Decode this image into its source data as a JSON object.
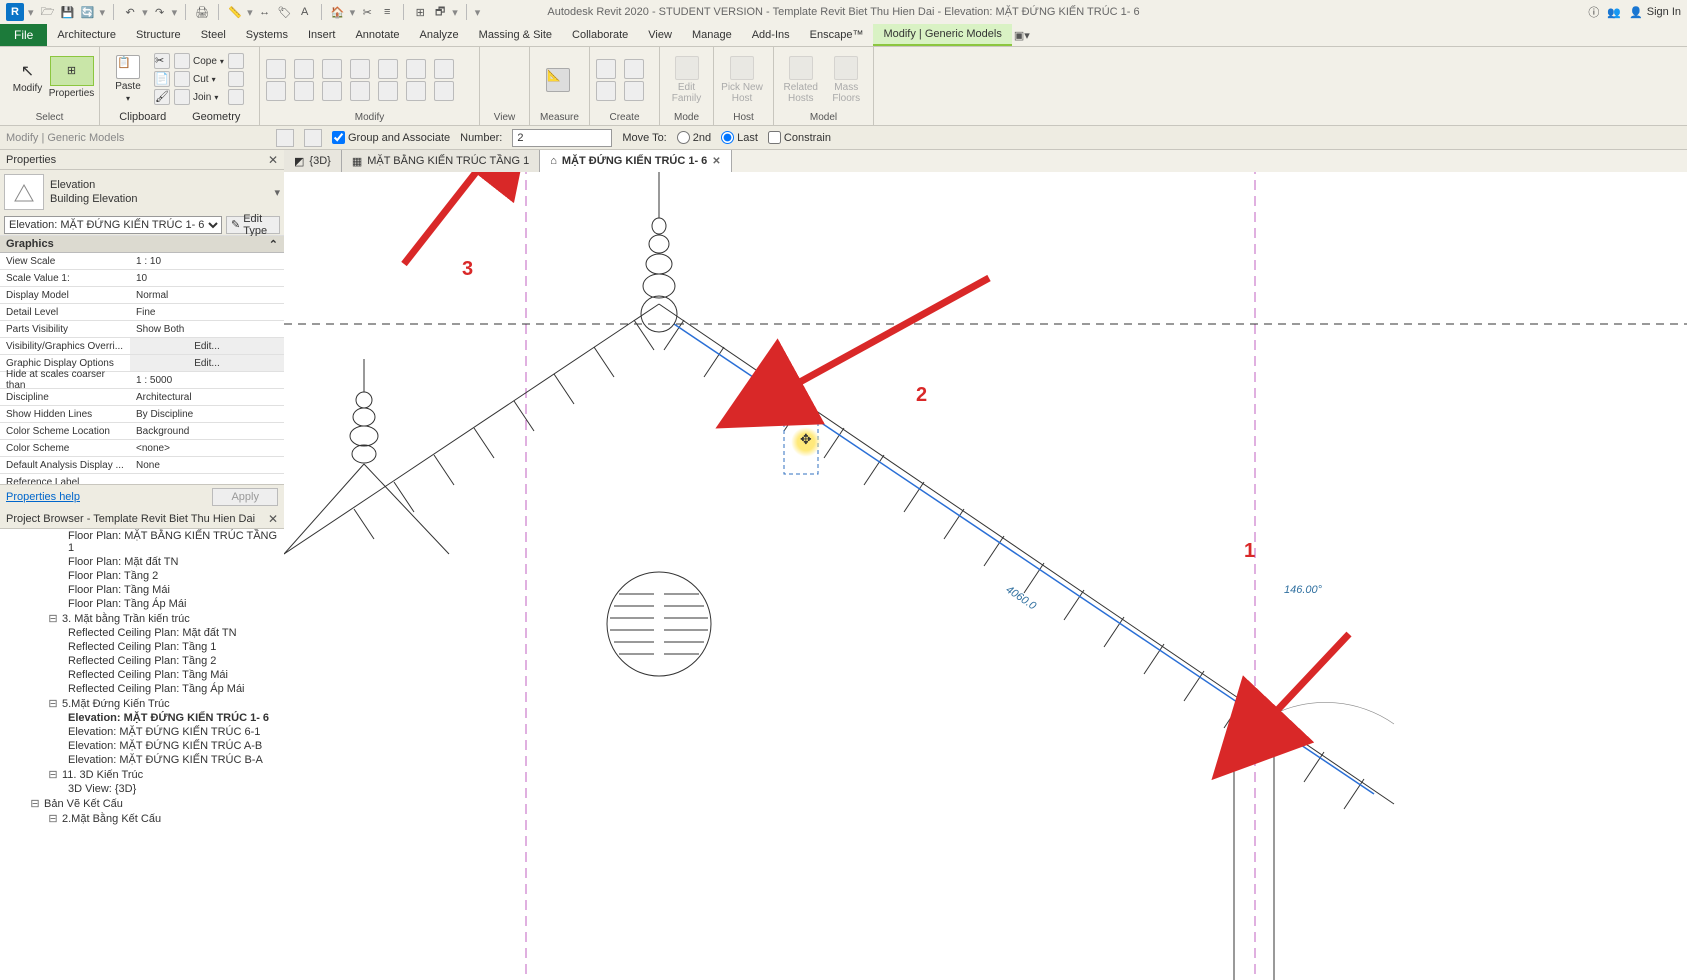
{
  "titlebar": {
    "logo": "R",
    "title": "Autodesk Revit 2020 - STUDENT VERSION - Template Revit Biet Thu Hien Dai - Elevation: MẶT ĐỨNG KIẾN TRÚC 1- 6",
    "sign_in": "Sign In"
  },
  "ribbon_tabs": [
    "File",
    "Architecture",
    "Structure",
    "Steel",
    "Systems",
    "Insert",
    "Annotate",
    "Analyze",
    "Massing & Site",
    "Collaborate",
    "View",
    "Manage",
    "Add-Ins",
    "Enscape™",
    "Modify | Generic Models"
  ],
  "ribbon": {
    "select": {
      "lbl": "Select",
      "btn": "Modify",
      "props": "Properties"
    },
    "clipboard": {
      "lbl": "Clipboard",
      "paste": "Paste",
      "cope": "Cope",
      "cut": "Cut",
      "join": "Join"
    },
    "geometry_lbl": "Geometry",
    "modify_lbl": "Modify",
    "view_lbl": "View",
    "measure_lbl": "Measure",
    "create_lbl": "Create",
    "mode": {
      "lbl": "Mode",
      "edit": "Edit Family"
    },
    "host": {
      "lbl": "Host",
      "pick": "Pick New Host"
    },
    "model": {
      "lbl": "Model",
      "related": "Related Hosts",
      "mass": "Mass Floors"
    }
  },
  "options": {
    "mode": "Modify | Generic Models",
    "group": "Group and Associate",
    "number_lbl": "Number:",
    "number_val": "2",
    "moveto": "Move To:",
    "second": "2nd",
    "last": "Last",
    "constrain": "Constrain"
  },
  "view_tabs": [
    {
      "icon": "3d",
      "label": "{3D}"
    },
    {
      "icon": "plan",
      "label": "MẶT BẰNG KIẾN TRÚC TẦNG 1"
    },
    {
      "icon": "elev",
      "label": "MẶT ĐỨNG KIẾN TRÚC 1- 6",
      "active": true
    }
  ],
  "props": {
    "panel": "Properties",
    "type1": "Elevation",
    "type2": "Building Elevation",
    "sel": "Elevation: MẶT ĐỨNG KIẾN TRÚC 1- 6",
    "edit_type": "Edit Type",
    "cat": "Graphics",
    "rows": [
      {
        "k": "View Scale",
        "v": "1 : 10"
      },
      {
        "k": "Scale Value    1:",
        "v": "10"
      },
      {
        "k": "Display Model",
        "v": "Normal"
      },
      {
        "k": "Detail Level",
        "v": "Fine"
      },
      {
        "k": "Parts Visibility",
        "v": "Show Both"
      },
      {
        "k": "Visibility/Graphics Overri...",
        "v": "Edit...",
        "btn": true
      },
      {
        "k": "Graphic Display Options",
        "v": "Edit...",
        "btn": true
      },
      {
        "k": "Hide at scales coarser than",
        "v": "1 : 5000"
      },
      {
        "k": "Discipline",
        "v": "Architectural"
      },
      {
        "k": "Show Hidden Lines",
        "v": "By Discipline"
      },
      {
        "k": "Color Scheme Location",
        "v": "Background"
      },
      {
        "k": "Color Scheme",
        "v": "<none>"
      },
      {
        "k": "Default Analysis Display ...",
        "v": "None"
      },
      {
        "k": "Reference Label",
        "v": ""
      }
    ],
    "help": "Properties help",
    "apply": "Apply"
  },
  "browser": {
    "title": "Project Browser - Template Revit Biet Thu Hien Dai",
    "items": [
      {
        "lvl": 3,
        "t": "Floor Plan: MẶT BẰNG KIẾN TRÚC TẦNG 1"
      },
      {
        "lvl": 3,
        "t": "Floor Plan: Mặt đất TN"
      },
      {
        "lvl": 3,
        "t": "Floor Plan: Tầng 2"
      },
      {
        "lvl": 3,
        "t": "Floor Plan: Tầng Mái"
      },
      {
        "lvl": 3,
        "t": "Floor Plan: Tầng Áp Mái"
      },
      {
        "lvl": 2,
        "exp": "-",
        "t": "3. Mặt bằng Trần kiến trúc"
      },
      {
        "lvl": 3,
        "t": "Reflected Ceiling Plan: Mặt đất TN"
      },
      {
        "lvl": 3,
        "t": "Reflected Ceiling Plan: Tầng 1"
      },
      {
        "lvl": 3,
        "t": "Reflected Ceiling Plan: Tầng 2"
      },
      {
        "lvl": 3,
        "t": "Reflected Ceiling Plan: Tầng Mái"
      },
      {
        "lvl": 3,
        "t": "Reflected Ceiling Plan: Tầng Áp Mái"
      },
      {
        "lvl": 2,
        "exp": "-",
        "t": "5.Mặt Đứng Kiến Trúc"
      },
      {
        "lvl": 3,
        "t": "Elevation: MẶT ĐỨNG KIẾN TRÚC 1- 6",
        "bold": true
      },
      {
        "lvl": 3,
        "t": "Elevation: MẶT ĐỨNG KIẾN TRÚC 6-1"
      },
      {
        "lvl": 3,
        "t": "Elevation: MẶT ĐỨNG KIẾN TRÚC A-B"
      },
      {
        "lvl": 3,
        "t": "Elevation: MẶT ĐỨNG KIẾN TRÚC B-A"
      },
      {
        "lvl": 2,
        "exp": "-",
        "t": "11. 3D Kiến Trúc"
      },
      {
        "lvl": 3,
        "t": "3D View: {3D}"
      },
      {
        "lvl": 1,
        "exp": "-",
        "t": "Bản Vẽ Kết Cấu"
      },
      {
        "lvl": 2,
        "exp": "-",
        "t": "2.Mặt Bằng Kết Cấu"
      }
    ]
  },
  "canvas": {
    "ann1": "1",
    "ann2": "2",
    "ann3": "3",
    "dim_len": "4060.0",
    "dim_ang": "146.00°"
  }
}
